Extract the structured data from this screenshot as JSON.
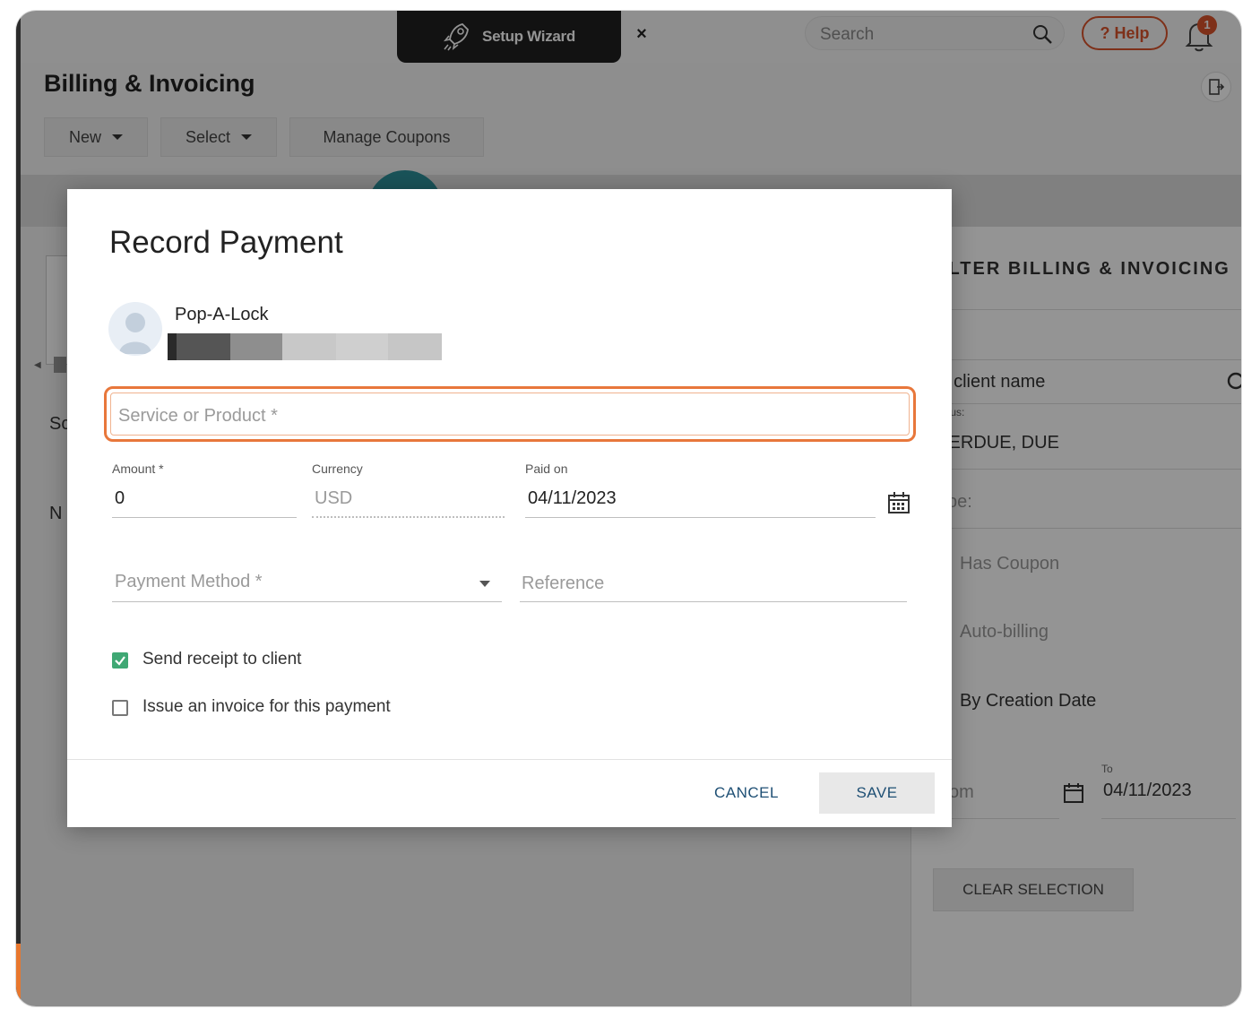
{
  "topbar": {
    "setup_wizard_label": "Setup Wizard",
    "close_symbol": "×",
    "search_placeholder": "Search",
    "help_label": "? Help",
    "notification_count": "1"
  },
  "header": {
    "title": "Billing & Invoicing",
    "buttons": {
      "new": "New",
      "select": "Select",
      "manage_coupons": "Manage Coupons"
    }
  },
  "background": {
    "fragment_sc": "Sc",
    "fragment_n": "N"
  },
  "filter_panel": {
    "title": "ILTER BILLING & INVOICING",
    "client_search_placeholder": "/ client name",
    "status_label": "tus:",
    "status_value": "/ERDUE, DUE",
    "type_placeholder": "pe:",
    "has_coupon": "Has Coupon",
    "auto_billing": "Auto-billing",
    "by_creation_date": "By Creation Date",
    "from_placeholder": "om",
    "to_label": "To",
    "to_value": "04/11/2023",
    "clear_selection": "CLEAR SELECTION"
  },
  "modal": {
    "title": "Record Payment",
    "client_name": "Pop-A-Lock",
    "service_placeholder": "Service or Product *",
    "amount_label": "Amount *",
    "amount_value": "0",
    "currency_label": "Currency",
    "currency_value": "USD",
    "paid_on_label": "Paid on",
    "paid_on_value": "04/11/2023",
    "payment_method_placeholder": "Payment Method *",
    "reference_placeholder": "Reference",
    "send_receipt_label": "Send receipt to client",
    "send_receipt_checked": true,
    "issue_invoice_label": "Issue an invoice for this payment",
    "issue_invoice_checked": false,
    "cancel_label": "CANCEL",
    "save_label": "SAVE"
  },
  "colors": {
    "accent_orange": "#e8773b",
    "help_red": "#d9532b",
    "checkbox_green": "#3fa874",
    "button_text_blue": "#1e4f74"
  },
  "icons": [
    "rocket-icon",
    "close-icon",
    "search-icon",
    "bell-icon",
    "exit-icon",
    "calendar-icon",
    "avatar-icon",
    "checkbox-icon",
    "dropdown-caret-icon"
  ]
}
